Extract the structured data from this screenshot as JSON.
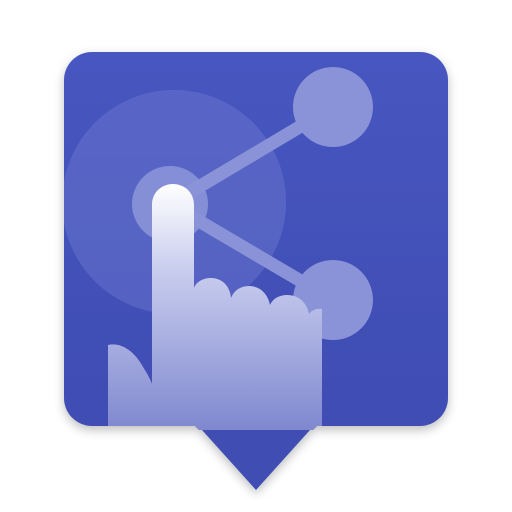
{
  "icon": {
    "name": "share-touch-app-icon",
    "colors": {
      "background": "#ffffff",
      "tile": "#4452bb",
      "tile_dark": "#3a47ab",
      "glow": "#6f7bd0",
      "node": "#8b93d8",
      "link": "#8b93d8",
      "hand_top": "#ffffff",
      "hand_bottom": "#7f88cf"
    }
  }
}
